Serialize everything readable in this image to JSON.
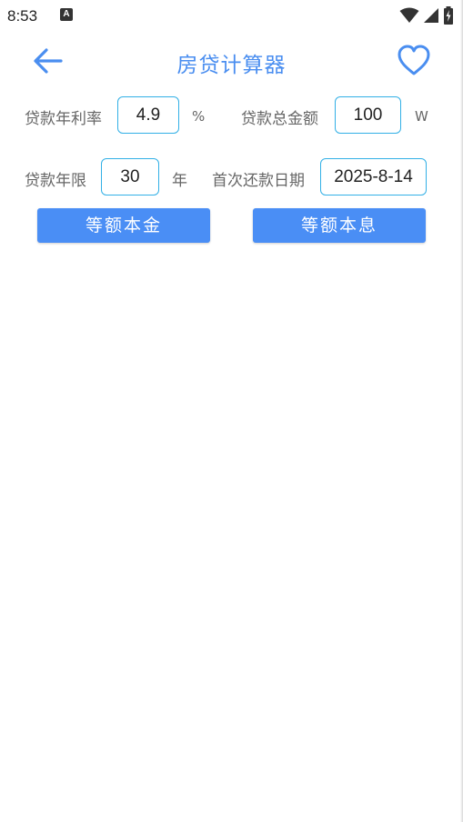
{
  "status_bar": {
    "time": "8:53",
    "notification_icon_glyph": "A",
    "icons": [
      "wifi-icon",
      "signal-icon",
      "battery-charging-icon"
    ]
  },
  "app_bar": {
    "title": "房贷计算器",
    "back_icon": "arrow-left-icon",
    "favorite_icon": "heart-outline-icon",
    "accent_color": "#4a8ef0"
  },
  "form": {
    "rate": {
      "label": "贷款年利率",
      "value": "4.9",
      "unit": "%"
    },
    "amount": {
      "label": "贷款总金额",
      "value": "100",
      "unit": "W"
    },
    "years": {
      "label": "贷款年限",
      "value": "30",
      "unit": "年"
    },
    "first_date": {
      "label": "首次还款日期",
      "value": "2025-8-14"
    }
  },
  "buttons": {
    "equal_principal": "等额本金",
    "equal_installment": "等额本息",
    "button_color": "#4a8ef5"
  }
}
